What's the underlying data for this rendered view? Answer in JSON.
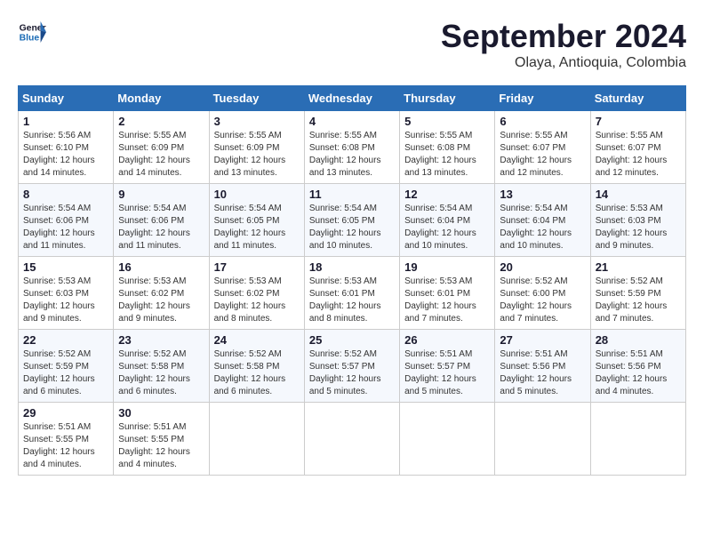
{
  "header": {
    "logo_line1": "General",
    "logo_line2": "Blue",
    "month": "September 2024",
    "location": "Olaya, Antioquia, Colombia"
  },
  "days_of_week": [
    "Sunday",
    "Monday",
    "Tuesday",
    "Wednesday",
    "Thursday",
    "Friday",
    "Saturday"
  ],
  "weeks": [
    [
      {
        "day": "1",
        "sunrise": "5:56 AM",
        "sunset": "6:10 PM",
        "daylight": "12 hours and 14 minutes."
      },
      {
        "day": "2",
        "sunrise": "5:55 AM",
        "sunset": "6:09 PM",
        "daylight": "12 hours and 14 minutes."
      },
      {
        "day": "3",
        "sunrise": "5:55 AM",
        "sunset": "6:09 PM",
        "daylight": "12 hours and 13 minutes."
      },
      {
        "day": "4",
        "sunrise": "5:55 AM",
        "sunset": "6:08 PM",
        "daylight": "12 hours and 13 minutes."
      },
      {
        "day": "5",
        "sunrise": "5:55 AM",
        "sunset": "6:08 PM",
        "daylight": "12 hours and 13 minutes."
      },
      {
        "day": "6",
        "sunrise": "5:55 AM",
        "sunset": "6:07 PM",
        "daylight": "12 hours and 12 minutes."
      },
      {
        "day": "7",
        "sunrise": "5:55 AM",
        "sunset": "6:07 PM",
        "daylight": "12 hours and 12 minutes."
      }
    ],
    [
      {
        "day": "8",
        "sunrise": "5:54 AM",
        "sunset": "6:06 PM",
        "daylight": "12 hours and 11 minutes."
      },
      {
        "day": "9",
        "sunrise": "5:54 AM",
        "sunset": "6:06 PM",
        "daylight": "12 hours and 11 minutes."
      },
      {
        "day": "10",
        "sunrise": "5:54 AM",
        "sunset": "6:05 PM",
        "daylight": "12 hours and 11 minutes."
      },
      {
        "day": "11",
        "sunrise": "5:54 AM",
        "sunset": "6:05 PM",
        "daylight": "12 hours and 10 minutes."
      },
      {
        "day": "12",
        "sunrise": "5:54 AM",
        "sunset": "6:04 PM",
        "daylight": "12 hours and 10 minutes."
      },
      {
        "day": "13",
        "sunrise": "5:54 AM",
        "sunset": "6:04 PM",
        "daylight": "12 hours and 10 minutes."
      },
      {
        "day": "14",
        "sunrise": "5:53 AM",
        "sunset": "6:03 PM",
        "daylight": "12 hours and 9 minutes."
      }
    ],
    [
      {
        "day": "15",
        "sunrise": "5:53 AM",
        "sunset": "6:03 PM",
        "daylight": "12 hours and 9 minutes."
      },
      {
        "day": "16",
        "sunrise": "5:53 AM",
        "sunset": "6:02 PM",
        "daylight": "12 hours and 9 minutes."
      },
      {
        "day": "17",
        "sunrise": "5:53 AM",
        "sunset": "6:02 PM",
        "daylight": "12 hours and 8 minutes."
      },
      {
        "day": "18",
        "sunrise": "5:53 AM",
        "sunset": "6:01 PM",
        "daylight": "12 hours and 8 minutes."
      },
      {
        "day": "19",
        "sunrise": "5:53 AM",
        "sunset": "6:01 PM",
        "daylight": "12 hours and 7 minutes."
      },
      {
        "day": "20",
        "sunrise": "5:52 AM",
        "sunset": "6:00 PM",
        "daylight": "12 hours and 7 minutes."
      },
      {
        "day": "21",
        "sunrise": "5:52 AM",
        "sunset": "5:59 PM",
        "daylight": "12 hours and 7 minutes."
      }
    ],
    [
      {
        "day": "22",
        "sunrise": "5:52 AM",
        "sunset": "5:59 PM",
        "daylight": "12 hours and 6 minutes."
      },
      {
        "day": "23",
        "sunrise": "5:52 AM",
        "sunset": "5:58 PM",
        "daylight": "12 hours and 6 minutes."
      },
      {
        "day": "24",
        "sunrise": "5:52 AM",
        "sunset": "5:58 PM",
        "daylight": "12 hours and 6 minutes."
      },
      {
        "day": "25",
        "sunrise": "5:52 AM",
        "sunset": "5:57 PM",
        "daylight": "12 hours and 5 minutes."
      },
      {
        "day": "26",
        "sunrise": "5:51 AM",
        "sunset": "5:57 PM",
        "daylight": "12 hours and 5 minutes."
      },
      {
        "day": "27",
        "sunrise": "5:51 AM",
        "sunset": "5:56 PM",
        "daylight": "12 hours and 5 minutes."
      },
      {
        "day": "28",
        "sunrise": "5:51 AM",
        "sunset": "5:56 PM",
        "daylight": "12 hours and 4 minutes."
      }
    ],
    [
      {
        "day": "29",
        "sunrise": "5:51 AM",
        "sunset": "5:55 PM",
        "daylight": "12 hours and 4 minutes."
      },
      {
        "day": "30",
        "sunrise": "5:51 AM",
        "sunset": "5:55 PM",
        "daylight": "12 hours and 4 minutes."
      },
      null,
      null,
      null,
      null,
      null
    ]
  ]
}
